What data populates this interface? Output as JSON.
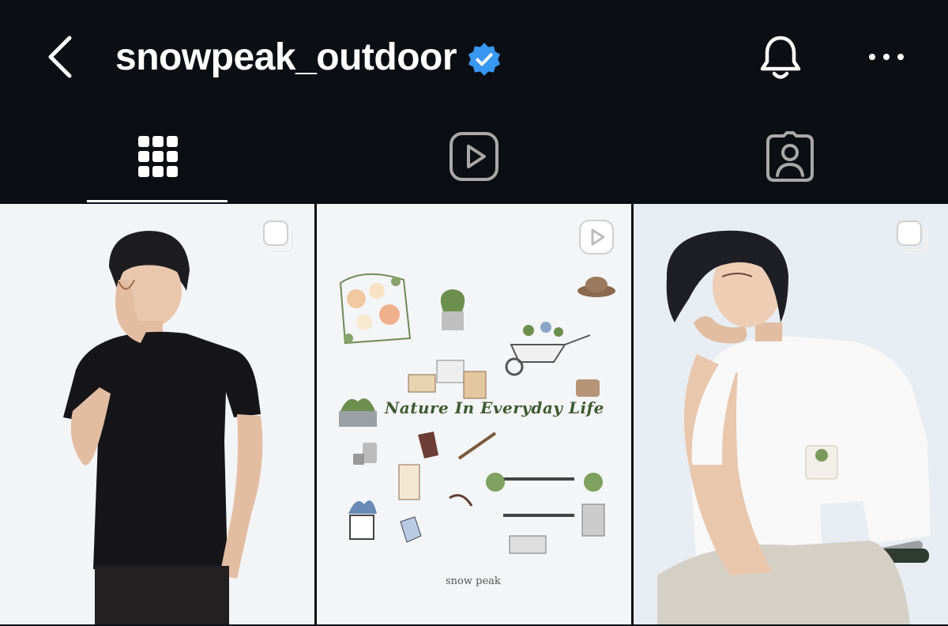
{
  "header": {
    "username": "snowpeak_outdoor",
    "verified": true
  },
  "icons": {
    "back": "chevron-left-icon",
    "verified": "verified-badge-icon",
    "bell": "bell-icon",
    "more": "more-horizontal-icon",
    "grid": "grid-icon",
    "reels": "reels-icon",
    "tagged": "tagged-icon"
  },
  "colors": {
    "background": "#0b0f14",
    "verified_blue": "#3897f0",
    "active_tab": "#ffffff",
    "inactive_tab": "#a8a8a8"
  },
  "tabs": [
    {
      "name": "posts",
      "active": true
    },
    {
      "name": "reels",
      "active": false
    },
    {
      "name": "tagged",
      "active": false
    }
  ],
  "posts": [
    {
      "type": "carousel",
      "badge_icon": "carousel-icon"
    },
    {
      "type": "reel",
      "badge_icon": "reel-play-icon",
      "caption": "Nature In Everyday Life",
      "brand": "snow peak"
    },
    {
      "type": "carousel",
      "badge_icon": "carousel-icon"
    }
  ]
}
